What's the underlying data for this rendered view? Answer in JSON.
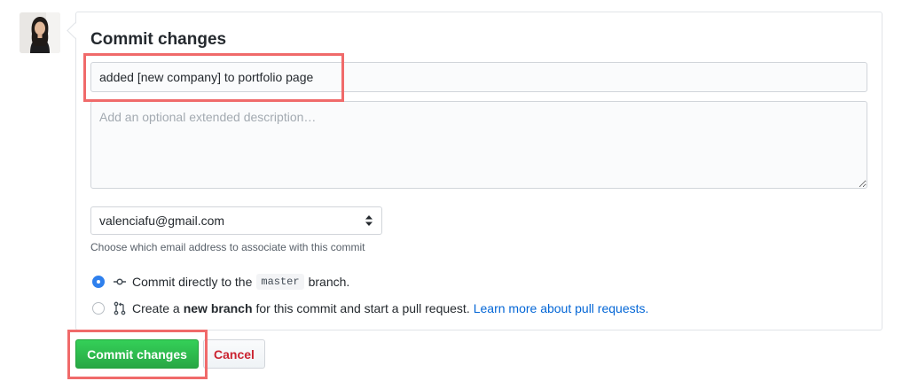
{
  "commit_form": {
    "title": "Commit changes",
    "summary_value": "added [new company] to portfolio page",
    "description_placeholder": "Add an optional extended description…",
    "email_selected": "valenciafu@gmail.com",
    "email_note": "Choose which email address to associate with this commit",
    "option_direct": {
      "prefix": "Commit directly to the",
      "branch_name": "master",
      "suffix": "branch."
    },
    "option_new_branch": {
      "prefix": "Create a",
      "bold_text": "new branch",
      "suffix": "for this commit and start a pull request.",
      "link_text": "Learn more about pull requests."
    },
    "commit_button_label": "Commit changes",
    "cancel_button_label": "Cancel"
  },
  "colors": {
    "accent_blue": "#0366d6",
    "commit_green": "#28a745",
    "cancel_red": "#cb2431",
    "highlight": "#f06a6a"
  },
  "icons": {
    "avatar": "user-avatar",
    "commit": "git-commit-icon",
    "pull_request": "git-pull-request-icon",
    "select_caret": "select-caret-icon"
  }
}
